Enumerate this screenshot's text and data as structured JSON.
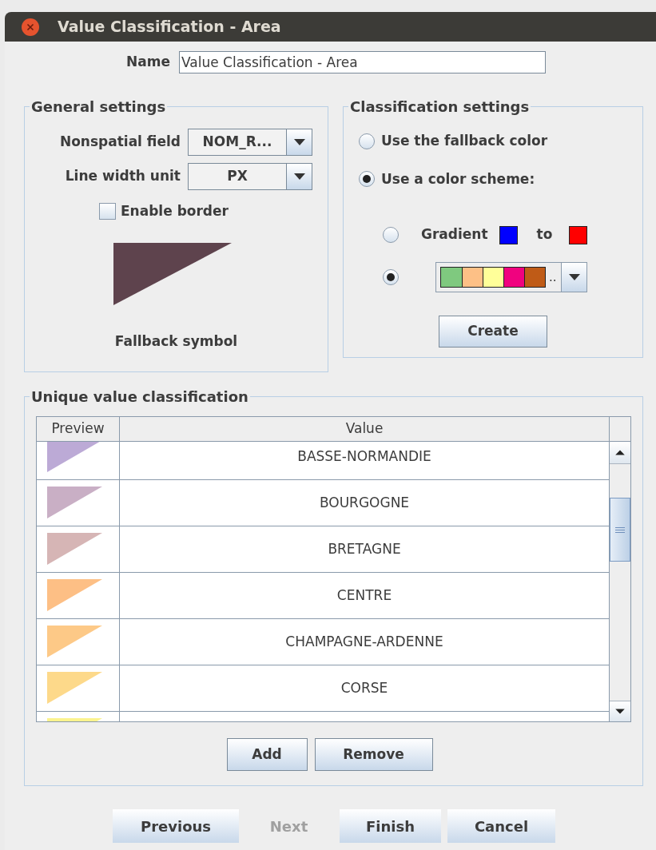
{
  "window": {
    "title": "Value Classification - Area"
  },
  "name": {
    "label": "Name",
    "value": "Value Classification - Area"
  },
  "general_settings": {
    "title": "General settings",
    "nonspatial_field": {
      "label": "Nonspatial field",
      "value": "NOM_R..."
    },
    "line_width_unit": {
      "label": "Line width unit",
      "value": "PX"
    },
    "enable_border": {
      "label": "Enable border",
      "checked": false
    },
    "fallback_symbol": {
      "label": "Fallback symbol"
    }
  },
  "classification_settings": {
    "title": "Classification settings",
    "options": [
      {
        "label": "Use the fallback color",
        "selected": false
      },
      {
        "label": "Use a color scheme:",
        "selected": true
      }
    ],
    "scheme_options": [
      {
        "kind": "gradient",
        "selected": false,
        "label": "Gradient",
        "connector": "to",
        "swatches": [
          {
            "color": "#0000ff"
          },
          {
            "color": "#ff0000"
          }
        ]
      },
      {
        "kind": "palette",
        "selected": true,
        "swatches": [
          {
            "color": "#7fc97f"
          },
          {
            "color": "#fdc086"
          },
          {
            "color": "#ffff99"
          },
          {
            "color": "#f0027f"
          },
          {
            "color": "#bf5b17"
          }
        ],
        "more": ".."
      }
    ],
    "create_button": "Create"
  },
  "unique_values": {
    "title": "Unique value classification",
    "columns": [
      "Preview",
      "Value"
    ],
    "rows": [
      {
        "color": "#bcaad6",
        "value": "BASSE-NORMANDIE"
      },
      {
        "color": "#c9afc5",
        "value": "BOURGOGNE"
      },
      {
        "color": "#d6b5b5",
        "value": "BRETAGNE"
      },
      {
        "color": "#fdbf85",
        "value": "CENTRE"
      },
      {
        "color": "#fdc987",
        "value": "CHAMPAGNE-ARDENNE"
      },
      {
        "color": "#fdd98a",
        "value": "CORSE"
      },
      {
        "color": "#fbf38e"
      }
    ],
    "buttons": [
      "Add",
      "Remove"
    ]
  },
  "footer_buttons": [
    {
      "label": "Previous",
      "disabled": false
    },
    {
      "label": "Next",
      "disabled": true
    },
    {
      "label": "Finish",
      "disabled": false
    },
    {
      "label": "Cancel",
      "disabled": false
    }
  ]
}
